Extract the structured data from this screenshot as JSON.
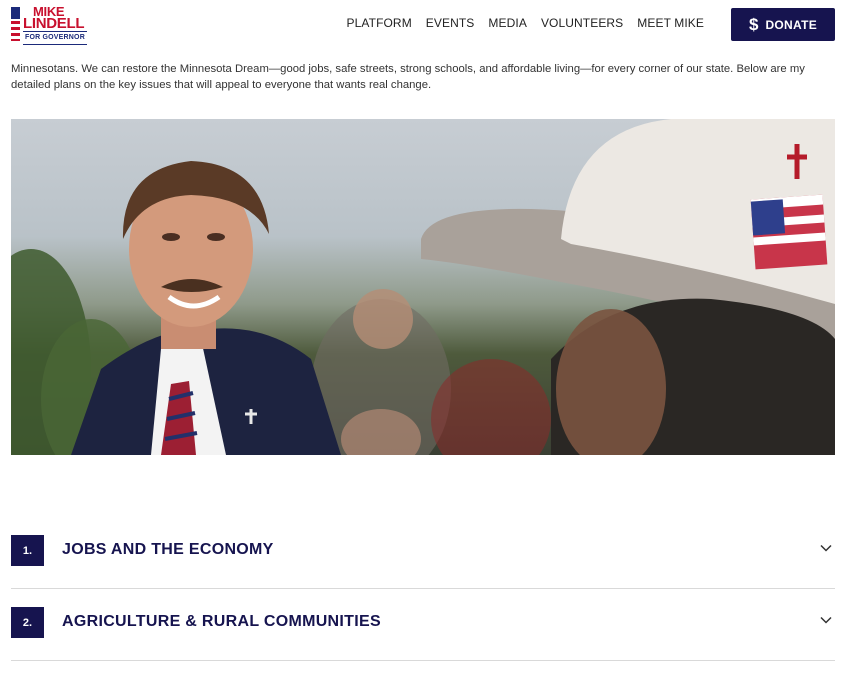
{
  "logo": {
    "line1": "MIKE",
    "line2": "LINDELL",
    "line3": "FOR GOVERNOR"
  },
  "nav": {
    "items": [
      "PLATFORM",
      "EVENTS",
      "MEDIA",
      "VOLUNTEERS",
      "MEET MIKE"
    ]
  },
  "donate": {
    "icon": "dollar-icon",
    "label": "DONATE"
  },
  "intro": {
    "text": "Minnesotans. We can restore the Minnesota Dream—good jobs, safe streets, strong schools, and affordable living—for every corner of our state. Below are my detailed plans on the key issues that will appeal to everyone that wants real change."
  },
  "accordion": {
    "items": [
      {
        "number": "1.",
        "title": "JOBS AND THE ECONOMY"
      },
      {
        "number": "2.",
        "title": "AGRICULTURE & RURAL COMMUNITIES"
      }
    ]
  },
  "colors": {
    "navy": "#16144f",
    "red": "#c8102e"
  }
}
